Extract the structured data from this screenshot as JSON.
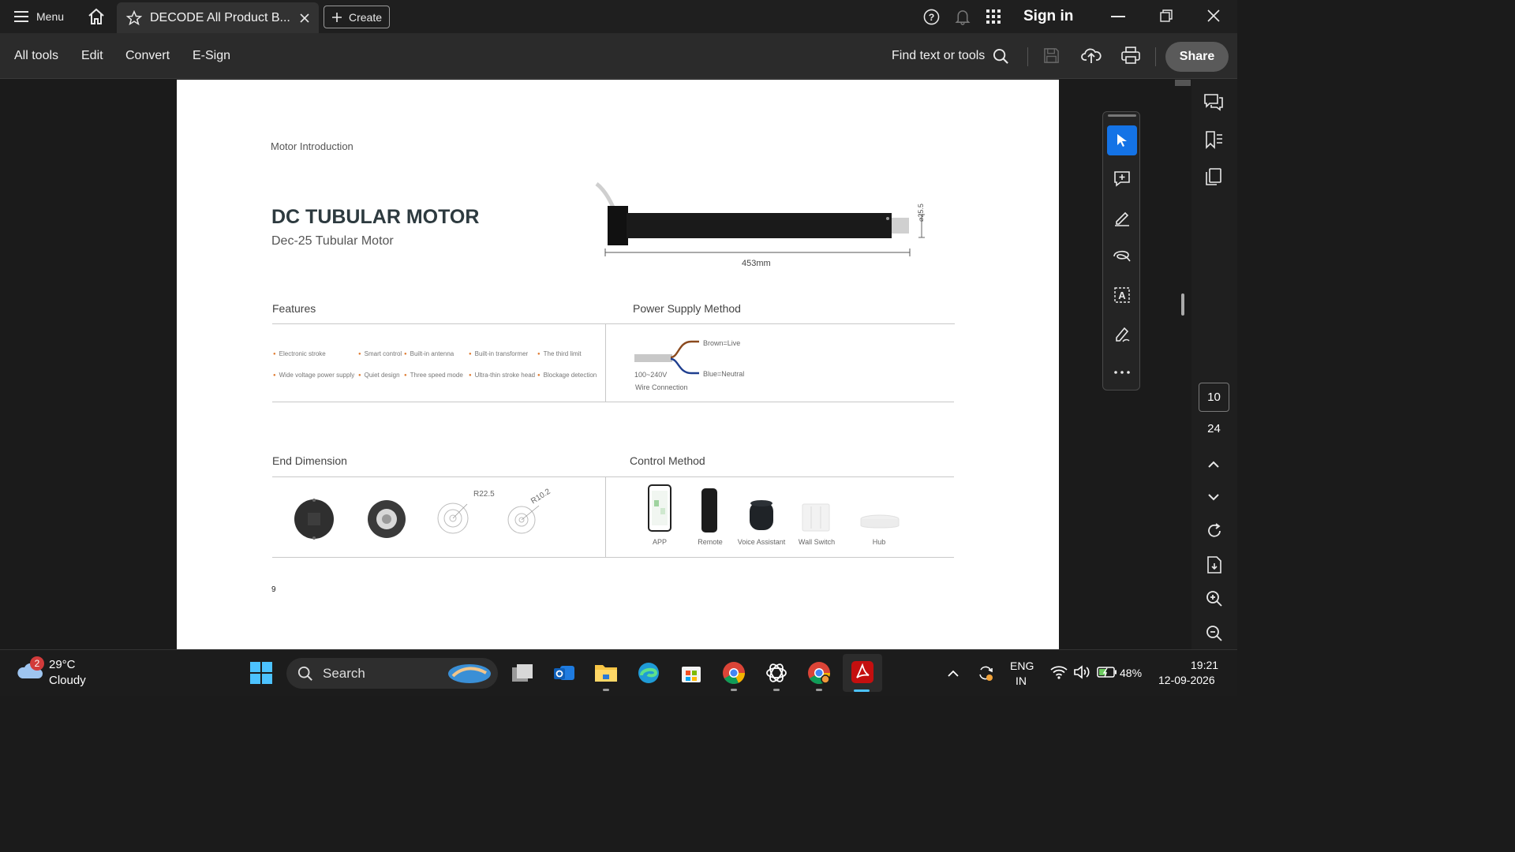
{
  "titlebar": {
    "menu_label": "Menu",
    "tab_title": "DECODE All Product B...",
    "create_label": "Create",
    "signin_label": "Sign in"
  },
  "toolbar": {
    "items": [
      "All tools",
      "Edit",
      "Convert",
      "E-Sign"
    ],
    "find_label": "Find text or tools",
    "share_label": "Share"
  },
  "page": {
    "header": "Motor Introduction",
    "title": "DC TUBULAR MOTOR",
    "subtitle": "Dec-25 Tubular Motor",
    "length_dim": "453mm",
    "diameter_dim": "⌀25.5",
    "features_heading": "Features",
    "features_row1": [
      "Electronic stroke",
      "Smart control",
      "Built-in antenna",
      "Built-in transformer",
      "The third limit"
    ],
    "features_row2": [
      "Wide voltage power supply",
      "Quiet design",
      "Three speed mode",
      "Ultra-thin stroke head",
      "Blockage detection"
    ],
    "power_heading": "Power Supply Method",
    "power_brown": "Brown=Live",
    "power_blue": "Blue=Neutral",
    "power_voltage": "100~240V",
    "power_conn": "Wire Connection",
    "end_heading": "End Dimension",
    "end_r1": "R22.5",
    "end_r2": "R10.2",
    "control_heading": "Control Method",
    "control_items": [
      "APP",
      "Remote",
      "Voice Assistant",
      "Wall Switch",
      "Hub"
    ],
    "page_number": "9"
  },
  "navigation": {
    "current_page": "10",
    "total_pages": "24"
  },
  "taskbar": {
    "weather_temp": "29°C",
    "weather_desc": "Cloudy",
    "weather_badge": "2",
    "search_label": "Search",
    "lang_top": "ENG",
    "lang_bottom": "IN",
    "battery": "48%",
    "time": "19:21",
    "date": "12-09-2026"
  },
  "colors": {
    "accent_blue": "#1473e6",
    "pdf_red": "#c40f0f",
    "feature_bullet": "#e07a2f"
  }
}
